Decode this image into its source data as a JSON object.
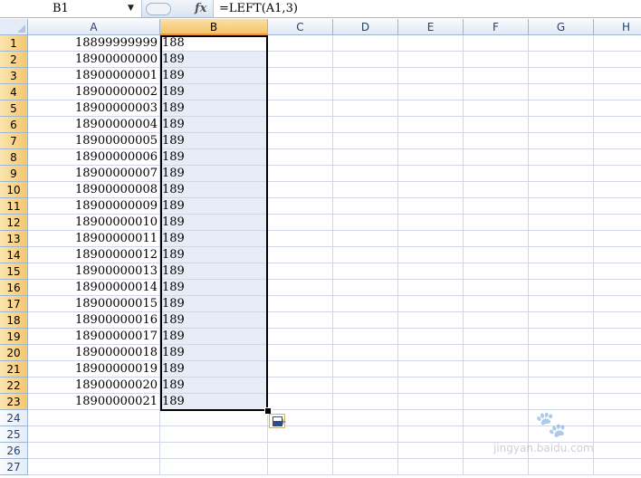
{
  "formula_bar": {
    "name_box": "B1",
    "fx": "fx",
    "formula": "=LEFT(A1,3)"
  },
  "columns": [
    "A",
    "B",
    "C",
    "D",
    "E",
    "F",
    "G",
    "H"
  ],
  "rows": [
    "1",
    "2",
    "3",
    "4",
    "5",
    "6",
    "7",
    "8",
    "9",
    "10",
    "11",
    "12",
    "13",
    "14",
    "15",
    "16",
    "17",
    "18",
    "19",
    "20",
    "21",
    "22",
    "23",
    "24",
    "25",
    "26",
    "27"
  ],
  "cells": {
    "A": [
      "18899999999",
      "18900000000",
      "18900000001",
      "18900000002",
      "18900000003",
      "18900000004",
      "18900000005",
      "18900000006",
      "18900000007",
      "18900000008",
      "18900000009",
      "18900000010",
      "18900000011",
      "18900000012",
      "18900000013",
      "18900000014",
      "18900000015",
      "18900000016",
      "18900000017",
      "18900000018",
      "18900000019",
      "18900000020",
      "18900000021"
    ],
    "B": [
      "188",
      "189",
      "189",
      "189",
      "189",
      "189",
      "189",
      "189",
      "189",
      "189",
      "189",
      "189",
      "189",
      "189",
      "189",
      "189",
      "189",
      "189",
      "189",
      "189",
      "189",
      "189",
      "189"
    ]
  },
  "selection": {
    "active_cell": "B1",
    "range": "B1:B23"
  },
  "watermark": "jingyan.baidu.com",
  "colors": {
    "header_border": "#9eb6ce",
    "gridline": "#d0d7e5",
    "selected_header": "#f6c66f",
    "selected_fill": "#e8ecf6"
  }
}
